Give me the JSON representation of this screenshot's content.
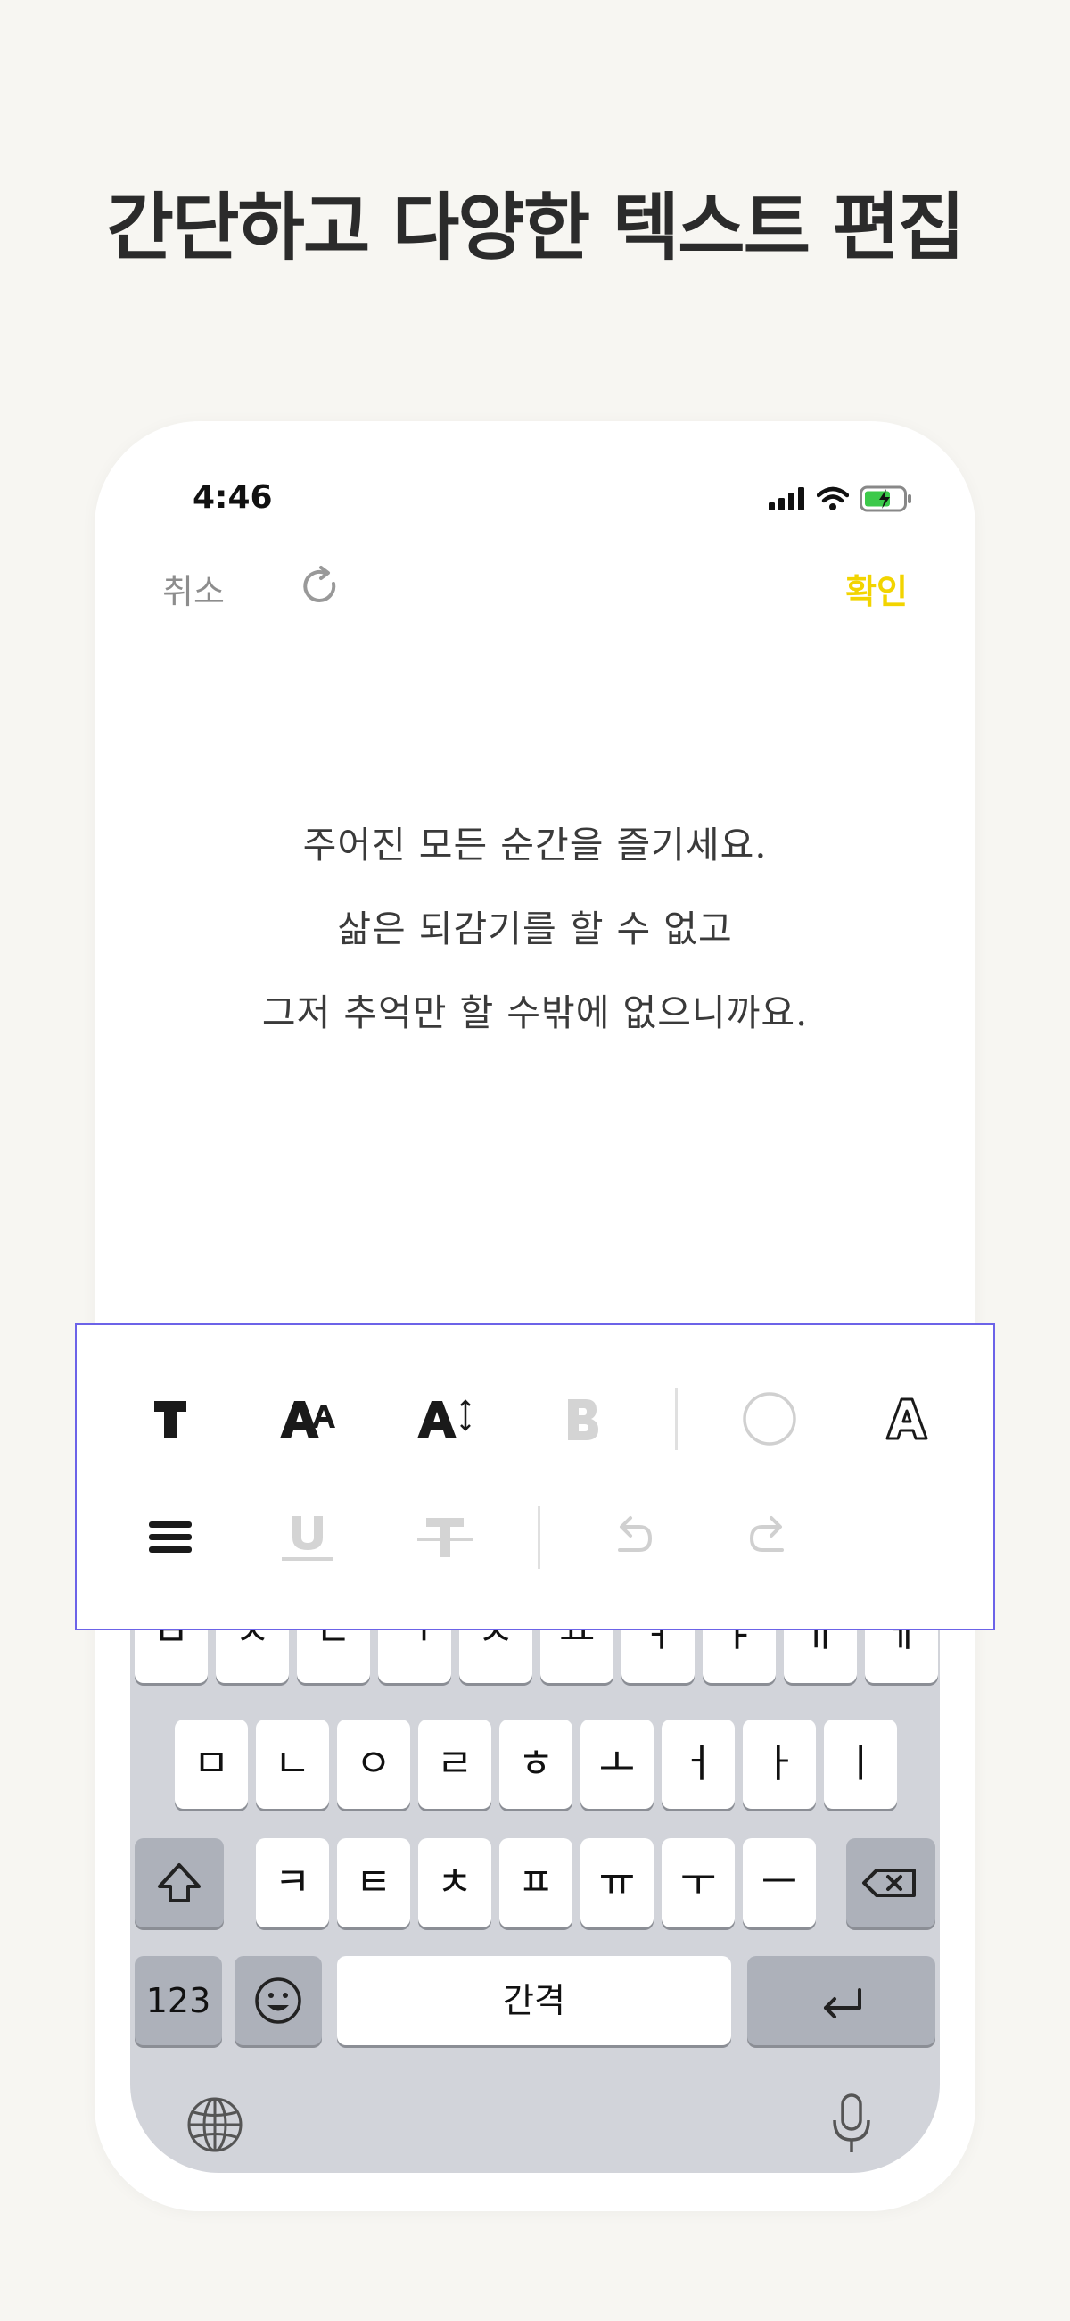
{
  "headline": "간단하고 다양한 텍스트 편집",
  "status_bar": {
    "time": "4:46"
  },
  "nav": {
    "cancel_label": "취소",
    "confirm_label": "확인"
  },
  "content_lines": [
    "주어진 모든 순간을 즐기세요.",
    "삶은 되감기를 할 수 없고",
    "그저 추억만 할 수밖에 없으니까요."
  ],
  "toolbar": {
    "row1": [
      "font-icon",
      "font-size-icon",
      "line-height-icon",
      "bold-icon",
      "text-color-icon",
      "outline-icon"
    ],
    "row2": [
      "align-icon",
      "underline-icon",
      "strikethrough-icon",
      "undo-icon",
      "redo-icon"
    ],
    "active_color": "#1a1a1a",
    "disabled_color": "#d0d0d0"
  },
  "keyboard": {
    "row1": [
      "ㅂ",
      "ㅈ",
      "ㄷ",
      "ㄱ",
      "ㅅ",
      "ㅛ",
      "ㅕ",
      "ㅑ",
      "ㅐ",
      "ㅔ"
    ],
    "row2": [
      "ㅁ",
      "ㄴ",
      "ㅇ",
      "ㄹ",
      "ㅎ",
      "ㅗ",
      "ㅓ",
      "ㅏ",
      "ㅣ"
    ],
    "row3": [
      "ㅋ",
      "ㅌ",
      "ㅊ",
      "ㅍ",
      "ㅠ",
      "ㅜ",
      "ㅡ"
    ],
    "numbers_label": "123",
    "space_label": "간격"
  },
  "colors": {
    "accent": "#f2d400",
    "background": "#f7f6f2",
    "selection_border": "#6c63e8"
  }
}
